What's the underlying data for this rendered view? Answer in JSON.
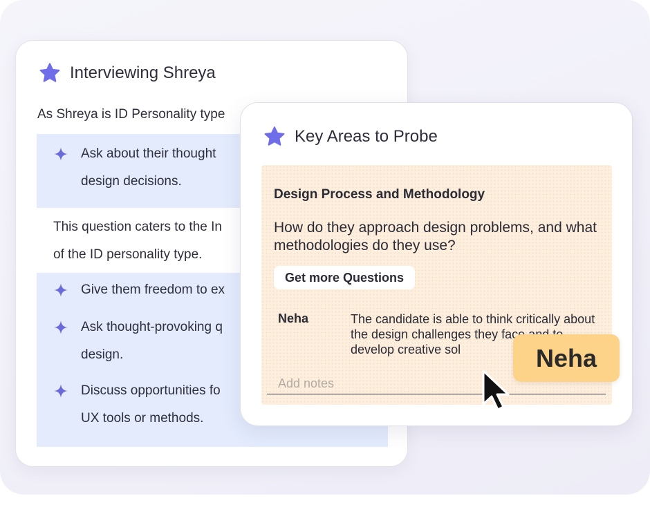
{
  "interview_card": {
    "title": "Interviewing Shreya",
    "intro": "As Shreya is ID Personality type",
    "tips_1": [
      {
        "line1": "Ask about their thought",
        "line2": "design decisions."
      }
    ],
    "explanation": {
      "line1": "This question caters to the In",
      "line2": "of the ID personality type."
    },
    "tips_2": [
      {
        "line1": "Give them freedom to ex"
      },
      {
        "line1": "Ask thought-provoking q",
        "line2": "design."
      },
      {
        "line1": "Discuss opportunities fo",
        "line2": "UX tools or methods."
      }
    ]
  },
  "probe_card": {
    "title": "Key Areas to Probe",
    "area": {
      "heading": "Design Process and Methodology",
      "question": "How do they approach design problems, and what methodologies do they use?",
      "more_button": "Get more Questions",
      "note": {
        "author": "Neha",
        "text": "The candidate is able to think critically about the design challenges they face and to develop creative sol"
      },
      "notes_placeholder": "Add notes"
    }
  },
  "cursor": {
    "label": "Neha"
  },
  "colors": {
    "accent_star": "#6f6ee8",
    "tip_background": "#e3ebfd",
    "probe_background": "#fdeedd",
    "cursor_tag": "#fdd38a"
  }
}
